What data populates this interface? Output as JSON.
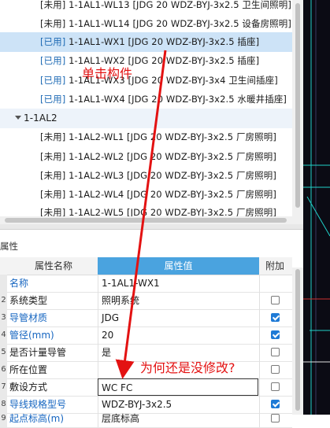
{
  "tree": {
    "rows": [
      {
        "tag": "[未用]",
        "text": " 1-1AL1-WL13 [JDG 20 WDZ-BYJ-3x2.5 卫生间照明]",
        "state": "unused"
      },
      {
        "tag": "[未用]",
        "text": " 1-1AL1-WL14 [JDG 20 WDZ-BYJ-3x2.5 设备房照明]",
        "state": "unused"
      },
      {
        "tag": "[已用]",
        "text": " 1-1AL1-WX1 [JDG 20 WDZ-BYJ-3x2.5 插座]",
        "state": "used",
        "selected": true
      },
      {
        "tag": "[已用]",
        "text": " 1-1AL1-WX2 [JDG 20 WDZ-BYJ-3x2.5 插座]",
        "state": "used"
      },
      {
        "tag": "[已用]",
        "text": " 1-1AL1-WX3 [JDG 20 WDZ-BYJ-3x4 卫生间插座]",
        "state": "used"
      },
      {
        "tag": "[已用]",
        "text": " 1-1AL1-WX4 [JDG 20 WDZ-BYJ-3x2.5 水暖井插座]",
        "state": "used"
      }
    ],
    "group": {
      "label": "1-1AL2"
    },
    "group_rows": [
      {
        "tag": "[未用]",
        "text": " 1-1AL2-WL1 [JDG 20 WDZ-BYJ-3x2.5 厂房照明]"
      },
      {
        "tag": "[未用]",
        "text": " 1-1AL2-WL2 [JDG 20 WDZ-BYJ-3x2.5 厂房照明]"
      },
      {
        "tag": "[未用]",
        "text": " 1-1AL2-WL3 [JDG 20 WDZ-BYJ-3x2.5 厂房照明]"
      },
      {
        "tag": "[未用]",
        "text": " 1-1AL2-WL4 [JDG 20 WDZ-BYJ-3x2.5 厂房照明]"
      },
      {
        "tag": "[未用]",
        "text": " 1-1AL2-WL5 [JDG 20 WDZ-BYJ-3x2.5 厂房照明]"
      }
    ]
  },
  "properties": {
    "title": "属性",
    "headers": {
      "name": "属性名称",
      "value": "属性值",
      "extra": "附加"
    },
    "rows": [
      {
        "num": "",
        "name": "名称",
        "value": "1-1AL1-WX1",
        "blue": true,
        "check": null
      },
      {
        "num": "2",
        "name": "系统类型",
        "value": "照明系统",
        "blue": false,
        "check": false
      },
      {
        "num": "3",
        "name": "导管材质",
        "value": "JDG",
        "blue": true,
        "check": true
      },
      {
        "num": "4",
        "name": "管径(mm)",
        "value": "20",
        "blue": true,
        "check": true
      },
      {
        "num": "5",
        "name": "是否计量导管",
        "value": "是",
        "blue": false,
        "check": false
      },
      {
        "num": "6",
        "name": "所在位置",
        "value": "",
        "blue": false,
        "check": false
      },
      {
        "num": "7",
        "name": "敷设方式",
        "value": "WC FC",
        "blue": false,
        "check": false,
        "editing": true
      },
      {
        "num": "8",
        "name": "导线规格型号",
        "value": "WDZ-BYJ-3x2.5",
        "blue": true,
        "check": true
      },
      {
        "num": "9",
        "name": "起点标高(m)",
        "value": "层底标高",
        "blue": true,
        "check": false
      }
    ]
  },
  "annotations": {
    "top": "单击构件",
    "bottom": "为何还是没修改?"
  },
  "colors": {
    "accent": "#4aa3df",
    "annotation": "#e31212",
    "selection": "#cde3f7",
    "used_tag": "#1f6bb5"
  }
}
